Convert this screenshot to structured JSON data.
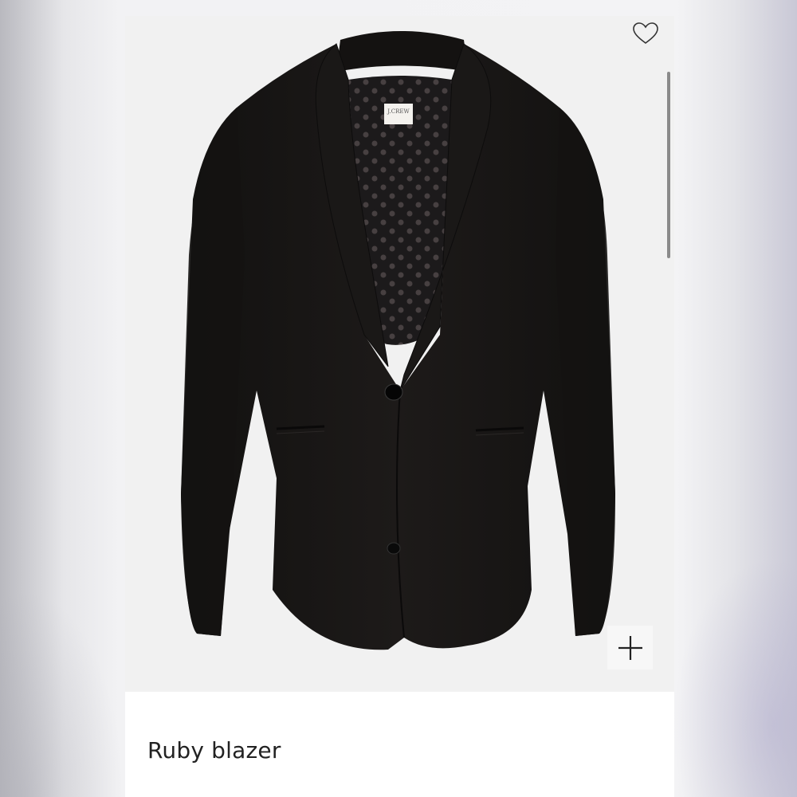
{
  "product": {
    "name": "Ruby blazer",
    "brand_label": "J.CREW",
    "image": {
      "subject": "black single-button blazer with shawl lapel and polka-dot lining"
    }
  },
  "icons": {
    "favorite": "heart-outline-icon",
    "add": "plus-icon"
  },
  "colors": {
    "card_background": "#ffffff",
    "image_background": "#f1f1f1",
    "blazer": "#161413",
    "text": "#222222"
  }
}
